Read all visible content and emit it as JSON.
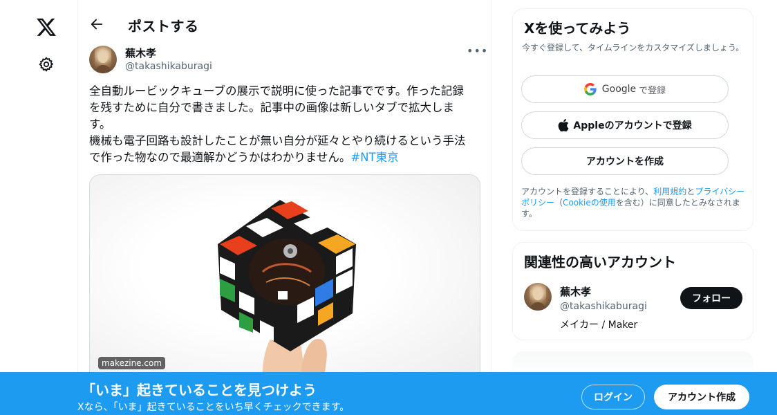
{
  "nav": {
    "logo_icon": "x-logo-icon",
    "settings_icon": "gear-icon"
  },
  "header": {
    "title": "ポストする",
    "back_icon": "arrow-left-icon"
  },
  "post": {
    "author_name": "蕪木孝",
    "author_handle": "@takashikaburagi",
    "more_label": "•••",
    "text_lines": [
      "全自動ルービックキューブの展示で説明に使った記事でです。作った記録",
      "を残すために自分で書きました。記事中の画像は新しいタブで拡大しま",
      "す。",
      "機械も電子回路も設計したことが無い自分が延々とやり続けるという手法"
    ],
    "last_line_text": "で作った物なので最適解かどうかはわかりません。",
    "hashtag": "#NT東京",
    "media_source": "makezine.com"
  },
  "signup_card": {
    "title": "Xを使ってみよう",
    "subtitle": "今すぐ登録して、タイムラインをカスタマイズしましょう。",
    "google_label": "Google",
    "google_suffix": "で登録",
    "apple_label": "Appleのアカウントで登録",
    "create_label": "アカウントを作成",
    "legal_prefix": "アカウントを登録することにより、",
    "legal_terms": "利用規約",
    "legal_and": "と",
    "legal_privacy": "プライバシーポリシー",
    "legal_paren_open": "（",
    "legal_cookie": "Cookieの使用",
    "legal_suffix": "を含む）に同意したとみなされます。"
  },
  "related_card": {
    "title": "関連性の高いアカウント",
    "name": "蕪木孝",
    "handle": "@takashikaburagi",
    "bio": "メイカー / Maker",
    "follow_label": "フォロー"
  },
  "banner": {
    "title": "「いま」起きていることを見つけよう",
    "subtitle": "Xなら、「いま」起きていることをいち早くチェックできます。",
    "login_label": "ログイン",
    "signup_label": "アカウント作成"
  },
  "colors": {
    "accent": "#1d9bf0",
    "text": "#0f1419",
    "muted": "#536471"
  }
}
